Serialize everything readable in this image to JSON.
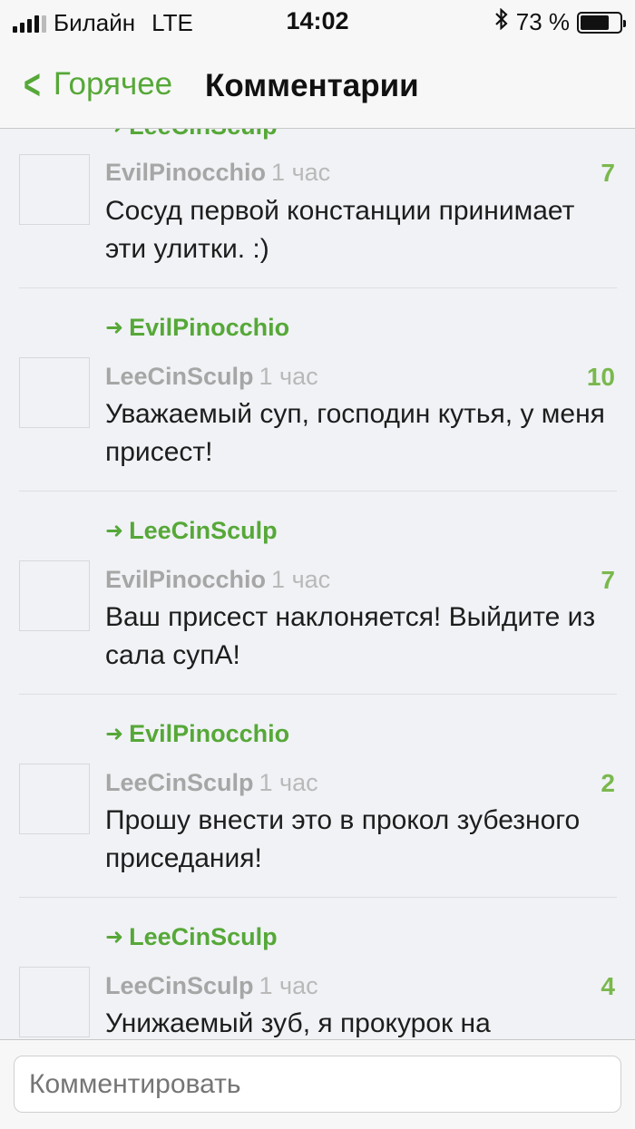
{
  "status_bar": {
    "carrier": "Билайн",
    "network": "LTE",
    "time": "14:02",
    "battery": "73 %",
    "battery_level": 0.73
  },
  "nav": {
    "back_label": "Горячее",
    "title": "Комментарии"
  },
  "feed": {
    "top_reply_to": "LeeCinSculp",
    "comments": [
      {
        "reply_to": "",
        "author": "EvilPinocchio",
        "time": "1 час",
        "score": "7",
        "text": "Сосуд первой констанции принимает эти улитки. :)"
      },
      {
        "reply_to": "EvilPinocchio",
        "author": "LeeCinSculp",
        "time": "1 час",
        "score": "10",
        "text": "Уважаемый суп, господин кутья, у меня присест!"
      },
      {
        "reply_to": "LeeCinSculp",
        "author": "EvilPinocchio",
        "time": "1 час",
        "score": "7",
        "text": "Ваш присест наклоняется! Выйдите из сала супА!"
      },
      {
        "reply_to": "EvilPinocchio",
        "author": "LeeCinSculp",
        "time": "1 час",
        "score": "2",
        "text": "Прошу внести это в прокол зубезного приседания!"
      },
      {
        "reply_to": "LeeCinSculp",
        "author": "LeeCinSculp",
        "time": "1 час",
        "score": "4",
        "text": "Унижаемый зуб, я прокурок на"
      }
    ]
  },
  "composer": {
    "placeholder": "Комментировать"
  },
  "colors": {
    "accent": "#56a838",
    "score": "#7ab84d",
    "background": "#f0f2f5"
  }
}
